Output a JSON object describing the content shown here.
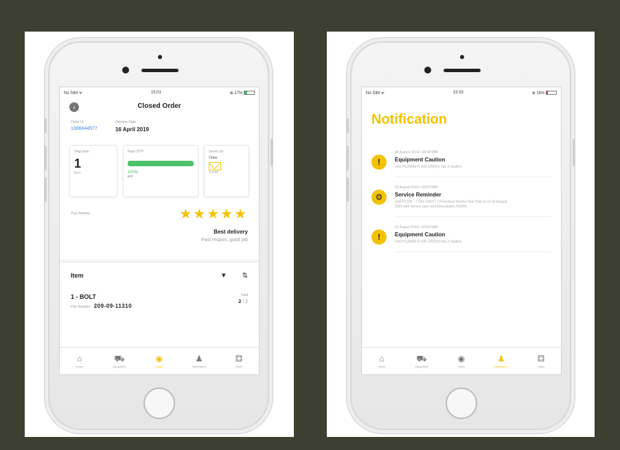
{
  "left_phone": {
    "status": {
      "carrier": "No SIM ᯤ",
      "time": "15:01",
      "battery": "⊕ 27%",
      "battery_level": 0.27
    },
    "nav": {
      "title": "Closed Order",
      "back_icon": "chevron-left-icon"
    },
    "meta": {
      "order_label": "Order Id",
      "order_value": "1006644577",
      "delivery_label": "Delivery Date",
      "delivery_value": "16 April 2019"
    },
    "cards": {
      "total_item_label": "Total Item",
      "total_item_value": "1",
      "total_item_unit": "Item",
      "parts_label": "Parts DTP",
      "parts_progress": 1.0,
      "parts_pct": "100%",
      "parts_foot": "DTP",
      "send_label": "Send List",
      "send_sub": "Order",
      "send_foot": "e-mail"
    },
    "review": {
      "label": "Your Review",
      "stars": "★★★★★",
      "rating": 5,
      "title": "Best delivery",
      "text": "Fast respon, good job"
    },
    "items": {
      "title": "Item",
      "filter_icon": "filter-icon",
      "sort_icon": "sort-icon",
      "rows": [
        {
          "name": "1 - BOLT",
          "pn_label": "Part Number",
          "pn": "209-09-11310",
          "total_label": "Total",
          "total_cur": "2",
          "total_max": " / 2"
        }
      ]
    },
    "tabs": [
      {
        "icon": "⌂",
        "label": "Home"
      },
      {
        "icon": "⛟",
        "label": "Equipment"
      },
      {
        "icon": "◉",
        "label": "Order"
      },
      {
        "icon": "♟",
        "label": "Notification"
      },
      {
        "icon": "⚃",
        "label": "Other"
      }
    ]
  },
  "right_phone": {
    "status": {
      "carrier": "No SIM ᯤ",
      "time": "15:53",
      "battery": "⊕ 16%",
      "battery_level": 0.16
    },
    "title": "Notification",
    "notifications": [
      {
        "icon": "!",
        "date": "04 August 2019 • 08:44 WIB",
        "title": "Equipment Caution",
        "text": "Unit PC2000E-8 (SN J20010) has 3 caution."
      },
      {
        "icon": "⚙",
        "date": "03 August 2019 • 08:53 WIB",
        "title": "Service Reminder",
        "text": "Unit PC200 - 7 (SN J12017 ) Periodical Service Due Date is on 10 August 2019 with service type recommendation PS250"
      },
      {
        "icon": "!",
        "date": "02 August 2019 • 10:04 WIB",
        "title": "Equipment Caution",
        "text": "Unit PC2000E-8 (SN J20010) has 2 caution."
      }
    ],
    "tabs": [
      {
        "icon": "⌂",
        "label": "Home"
      },
      {
        "icon": "⛟",
        "label": "Equipment"
      },
      {
        "icon": "◉",
        "label": "Order"
      },
      {
        "icon": "♟",
        "label": "Notification"
      },
      {
        "icon": "⚃",
        "label": "Other"
      }
    ]
  }
}
